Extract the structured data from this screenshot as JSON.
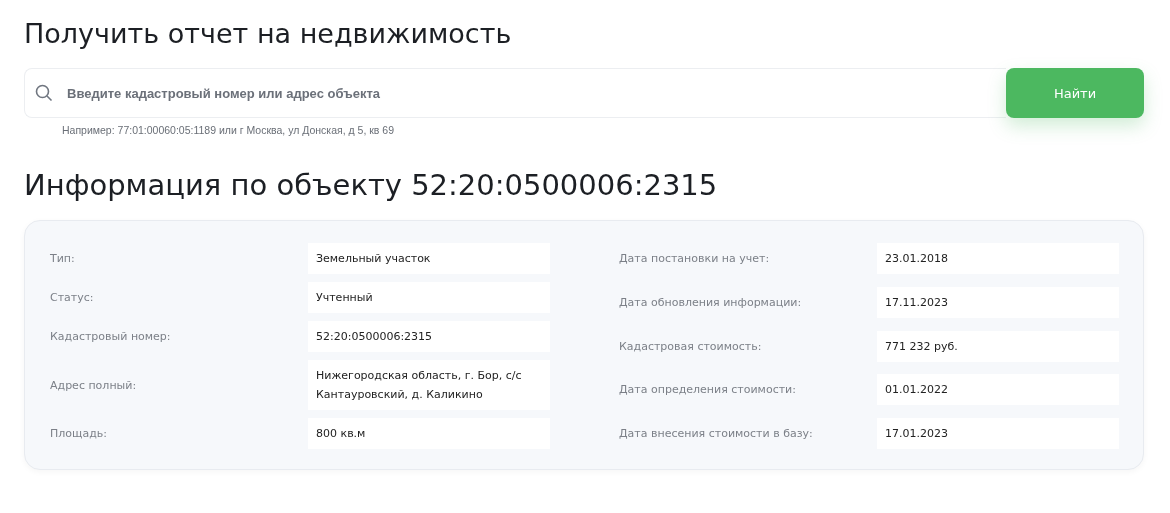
{
  "title": "Получить отчет на недвижимость",
  "search": {
    "placeholder": "Введите кадастровый номер или адрес объекта",
    "button": "Найти",
    "hint": "Например: 77:01:00060:05:1189 или г Москва, ул Донская, д 5, кв 69"
  },
  "info": {
    "heading": "Информация по объекту 52:20:0500006:2315",
    "left": [
      {
        "label": "Тип:",
        "value": "Земельный участок"
      },
      {
        "label": "Статус:",
        "value": "Учтенный"
      },
      {
        "label": "Кадастровый номер:",
        "value": "52:20:0500006:2315"
      },
      {
        "label": "Адрес полный:",
        "value": "Нижегородская область, г. Бор, с/с Кантауровский, д. Каликино"
      },
      {
        "label": "Площадь:",
        "value": "800 кв.м"
      }
    ],
    "right": [
      {
        "label": "Дата постановки на учет:",
        "value": "23.01.2018"
      },
      {
        "label": "Дата обновления информации:",
        "value": "17.11.2023"
      },
      {
        "label": "Кадастровая стоимость:",
        "value": "771 232 руб."
      },
      {
        "label": "Дата определения стоимости:",
        "value": "01.01.2022"
      },
      {
        "label": "Дата внесения стоимости в базу:",
        "value": "17.01.2023"
      }
    ]
  }
}
